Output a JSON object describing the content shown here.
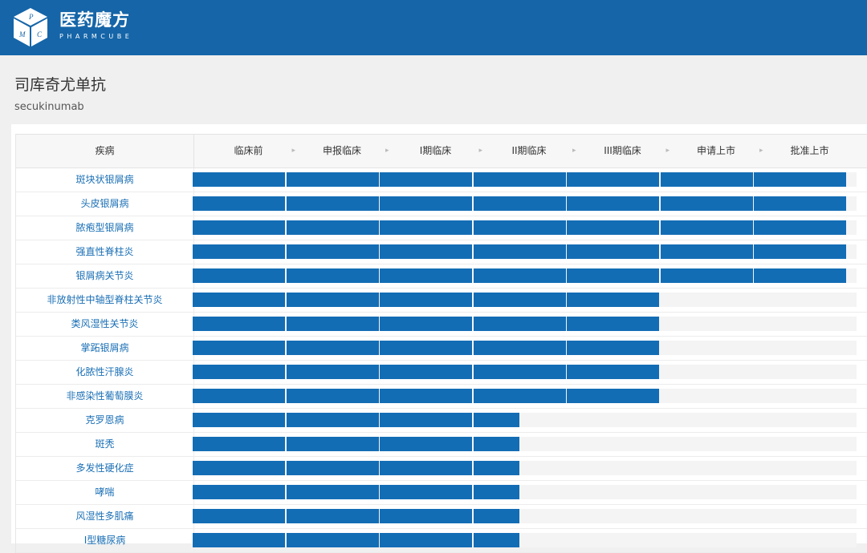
{
  "app": {
    "brand_cn": "医药魔方",
    "brand_en": "PHARMCUBE",
    "logo_letters": [
      "P",
      "M",
      "C"
    ]
  },
  "drug": {
    "name_cn": "司库奇尤单抗",
    "name_en": "secukinumab"
  },
  "table": {
    "disease_header": "疾病",
    "phases": [
      "临床前",
      "申报临床",
      "I期临床",
      "II期临床",
      "III期临床",
      "申请上市",
      "批准上市"
    ],
    "separator": "▸",
    "bar_color": "#136db5",
    "rows": [
      {
        "disease": "斑块状银屑病",
        "progress": 7
      },
      {
        "disease": "头皮银屑病",
        "progress": 7
      },
      {
        "disease": "脓疱型银屑病",
        "progress": 7
      },
      {
        "disease": "强直性脊柱炎",
        "progress": 7
      },
      {
        "disease": "银屑病关节炎",
        "progress": 7
      },
      {
        "disease": "非放射性中轴型脊柱关节炎",
        "progress": 5
      },
      {
        "disease": "类风湿性关节炎",
        "progress": 5
      },
      {
        "disease": "掌跖银屑病",
        "progress": 5
      },
      {
        "disease": "化脓性汗腺炎",
        "progress": 5
      },
      {
        "disease": "非感染性葡萄膜炎",
        "progress": 5
      },
      {
        "disease": "克罗恩病",
        "progress": 3.5
      },
      {
        "disease": "斑秃",
        "progress": 3.5
      },
      {
        "disease": "多发性硬化症",
        "progress": 3.5
      },
      {
        "disease": "哮喘",
        "progress": 3.5
      },
      {
        "disease": "风湿性多肌痛",
        "progress": 3.5
      },
      {
        "disease": "I型糖尿病",
        "progress": 3.5
      }
    ]
  }
}
